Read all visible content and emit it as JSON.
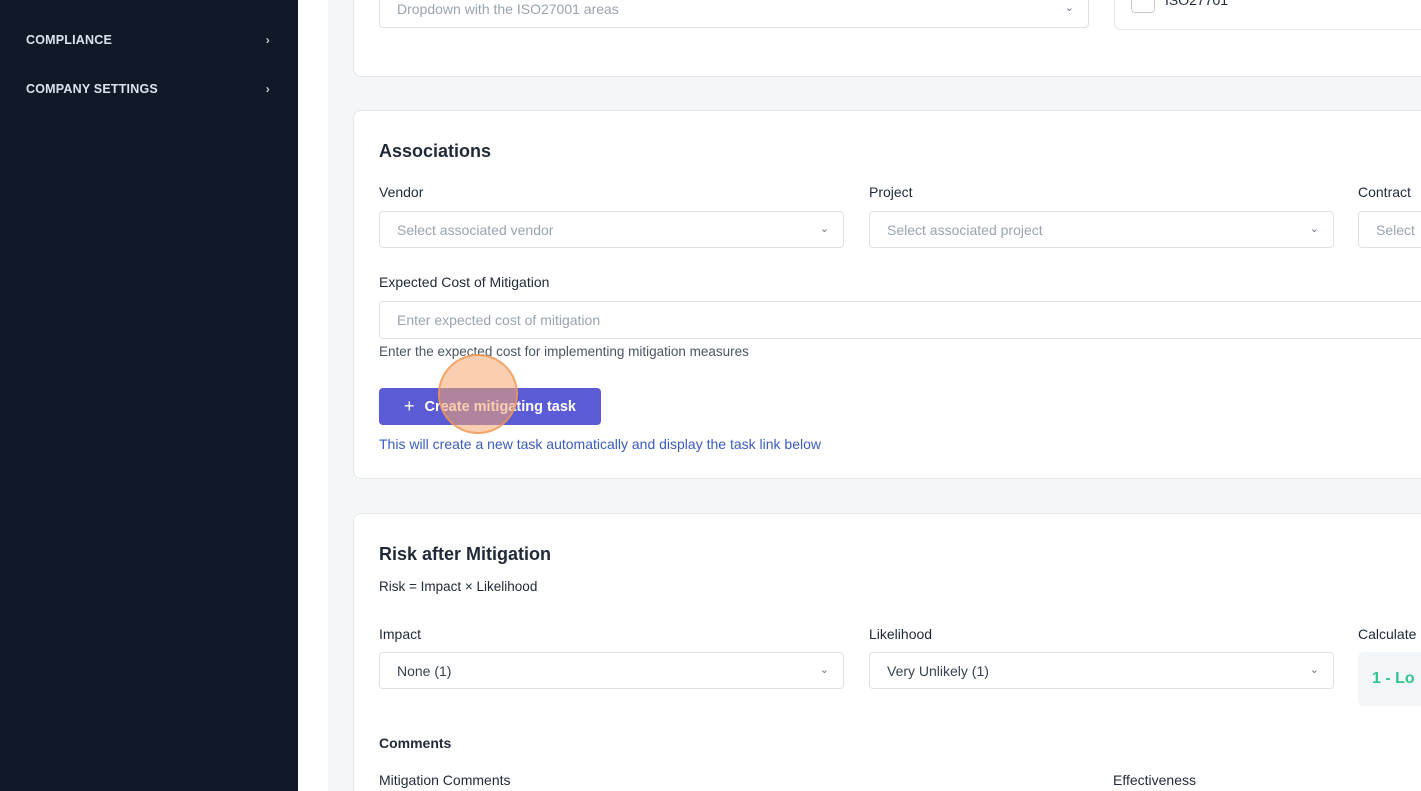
{
  "sidebar": {
    "items": [
      {
        "label": "COMPLIANCE",
        "chevron": "›"
      },
      {
        "label": "COMPANY SETTINGS",
        "chevron": "›"
      }
    ]
  },
  "top_section": {
    "iso_dropdown_placeholder": "Dropdown with the ISO27001 areas",
    "iso_checkbox_label": "ISO27701"
  },
  "associations": {
    "title": "Associations",
    "vendor_label": "Vendor",
    "vendor_placeholder": "Select associated vendor",
    "project_label": "Project",
    "project_placeholder": "Select associated project",
    "contract_label": "Contract",
    "contract_placeholder": "Select",
    "cost_label": "Expected Cost of Mitigation",
    "cost_placeholder": "Enter expected cost of mitigation",
    "cost_help": "Enter the expected cost for implementing mitigation measures",
    "create_task_label": "Create mitigating task",
    "create_task_icon": "+",
    "create_task_help": "This will create a new task automatically and display the task link below"
  },
  "risk_after": {
    "title": "Risk after Mitigation",
    "formula": "Risk = Impact × Likelihood",
    "impact_label": "Impact",
    "impact_value": "None (1)",
    "likelihood_label": "Likelihood",
    "likelihood_value": "Very Unlikely (1)",
    "calculated_label": "Calculate",
    "calculated_value": "1 - Lo",
    "comments_title": "Comments",
    "mitigation_comments_label": "Mitigation Comments",
    "effectiveness_label": "Effectiveness"
  },
  "colors": {
    "sidebar_bg": "#111827",
    "primary_button": "#5b5bd6",
    "link_text": "#3b5bbf",
    "risk_low": "#34c38f"
  }
}
